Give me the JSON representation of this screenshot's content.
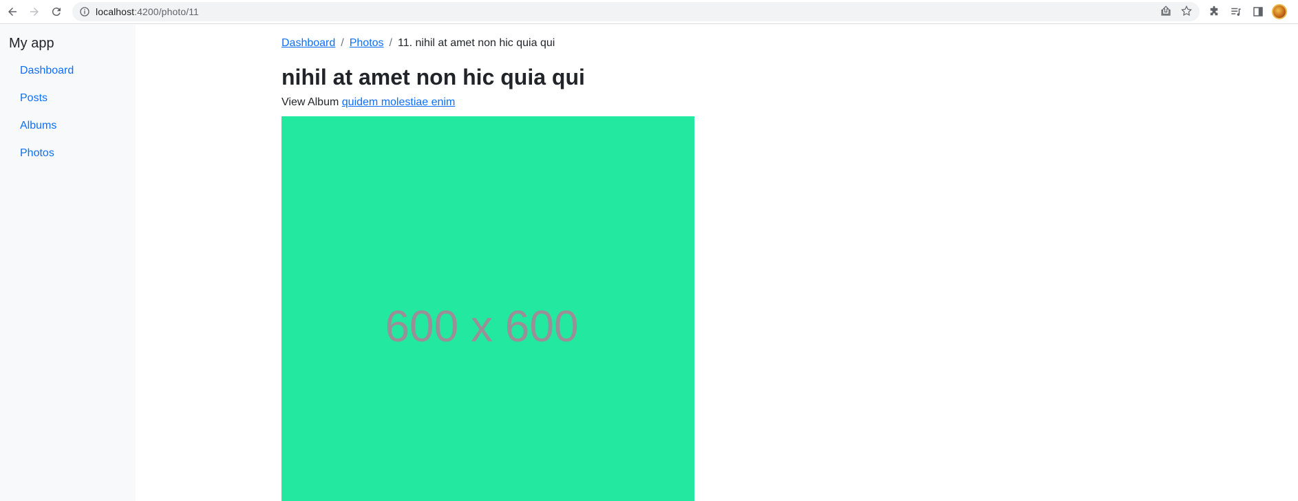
{
  "browser": {
    "url_host": "localhost",
    "url_path": ":4200/photo/11"
  },
  "sidebar": {
    "brand": "My app",
    "items": [
      {
        "label": "Dashboard"
      },
      {
        "label": "Posts"
      },
      {
        "label": "Albums"
      },
      {
        "label": "Photos"
      }
    ]
  },
  "breadcrumb": {
    "items": [
      {
        "label": "Dashboard"
      },
      {
        "label": "Photos"
      }
    ],
    "separator": "/",
    "active": "11. nihil at amet non hic quia qui"
  },
  "page": {
    "title": "nihil at amet non hic quia qui",
    "album_prefix": "View Album",
    "album_link": "quidem molestiae enim",
    "photo_label": "600 x 600",
    "photo_color": "#22e8a0"
  },
  "colors": {
    "link": "#0d6efd",
    "sidebar_bg": "#f8f9fa"
  }
}
